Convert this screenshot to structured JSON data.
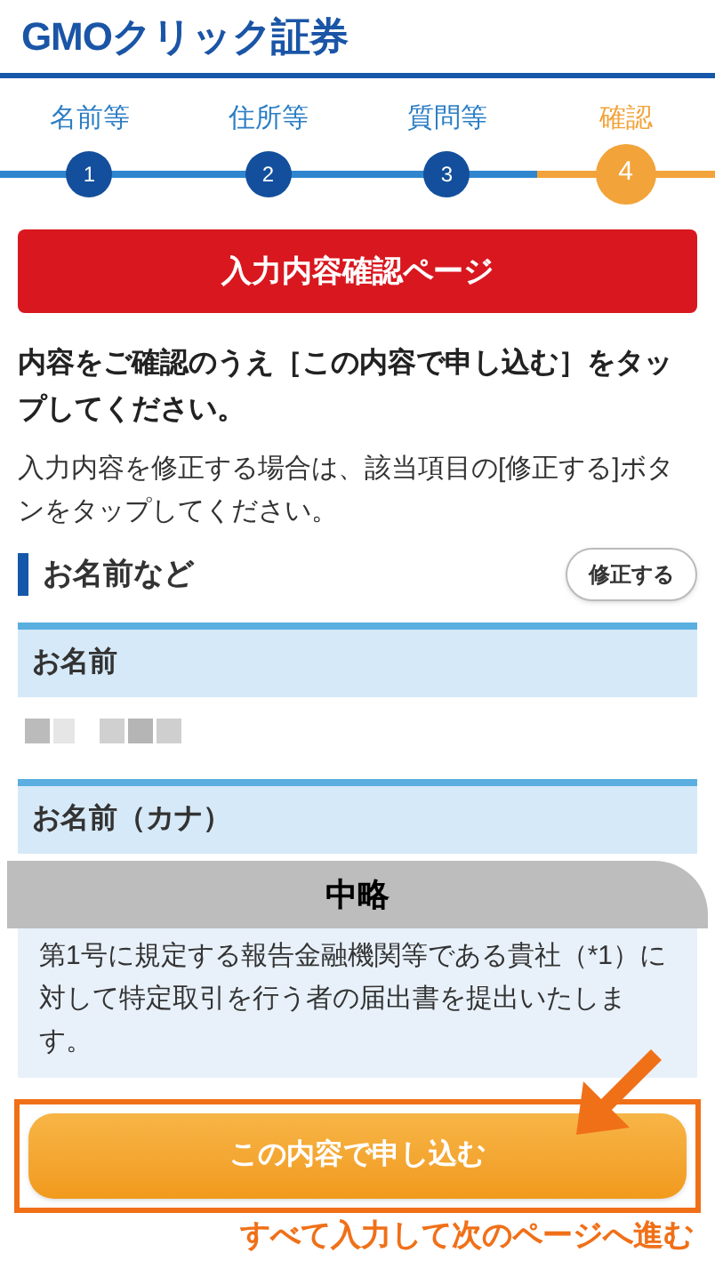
{
  "logo": "GMOクリック証券",
  "steps": [
    {
      "label": "名前等",
      "number": "1",
      "selected": false
    },
    {
      "label": "住所等",
      "number": "2",
      "selected": false
    },
    {
      "label": "質問等",
      "number": "3",
      "selected": false
    },
    {
      "label": "確認",
      "number": "4",
      "selected": true
    }
  ],
  "banner": "入力内容確認ページ",
  "instruction": "内容をご確認のうえ［この内容で申し込む］をタップしてください。",
  "note": "入力内容を修正する場合は、該当項目の[修正する]ボタンをタップしてください。",
  "section": {
    "title": "お名前など",
    "edit_button": "修正する"
  },
  "fields": [
    {
      "label": "お名前"
    },
    {
      "label": "お名前（カナ）"
    }
  ],
  "omission": "中略",
  "declaration": "第1号に規定する報告金融機関等である貴社（*1）に対して特定取引を行う者の届出書を提出いたします。",
  "submit_button": "この内容で申し込む",
  "callout": "すべて入力して次のページへ進む"
}
